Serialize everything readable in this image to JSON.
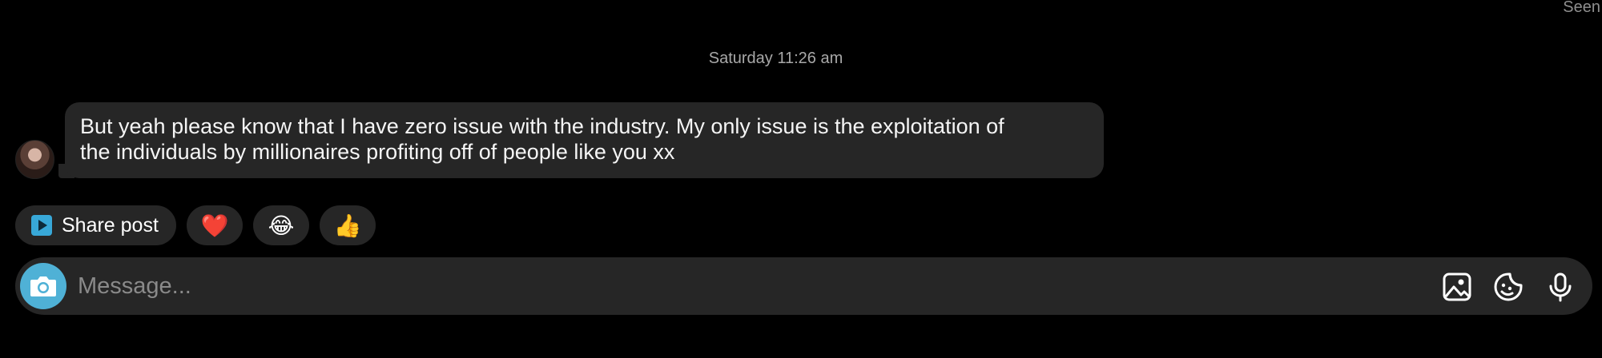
{
  "status": {
    "seen_label": "Seen"
  },
  "thread": {
    "timestamp": "Saturday 11:26 am",
    "messages": [
      {
        "line1": "But yeah please know that I have zero issue with the industry. My only issue is the exploitation of",
        "line2": "the individuals by millionaires profiting off of people like you xx"
      }
    ]
  },
  "quick_replies": {
    "share_label": "Share post",
    "reactions": [
      "❤️",
      "😂",
      "👍"
    ]
  },
  "composer": {
    "placeholder": "Message..."
  },
  "icons": {
    "camera": "camera-icon",
    "gallery": "image-icon",
    "sticker": "sticker-icon",
    "mic": "microphone-icon",
    "share": "play-icon"
  },
  "colors": {
    "background": "#000000",
    "bubble": "#262626",
    "accent": "#4fb1d6",
    "muted_text": "#8e8e8e"
  }
}
